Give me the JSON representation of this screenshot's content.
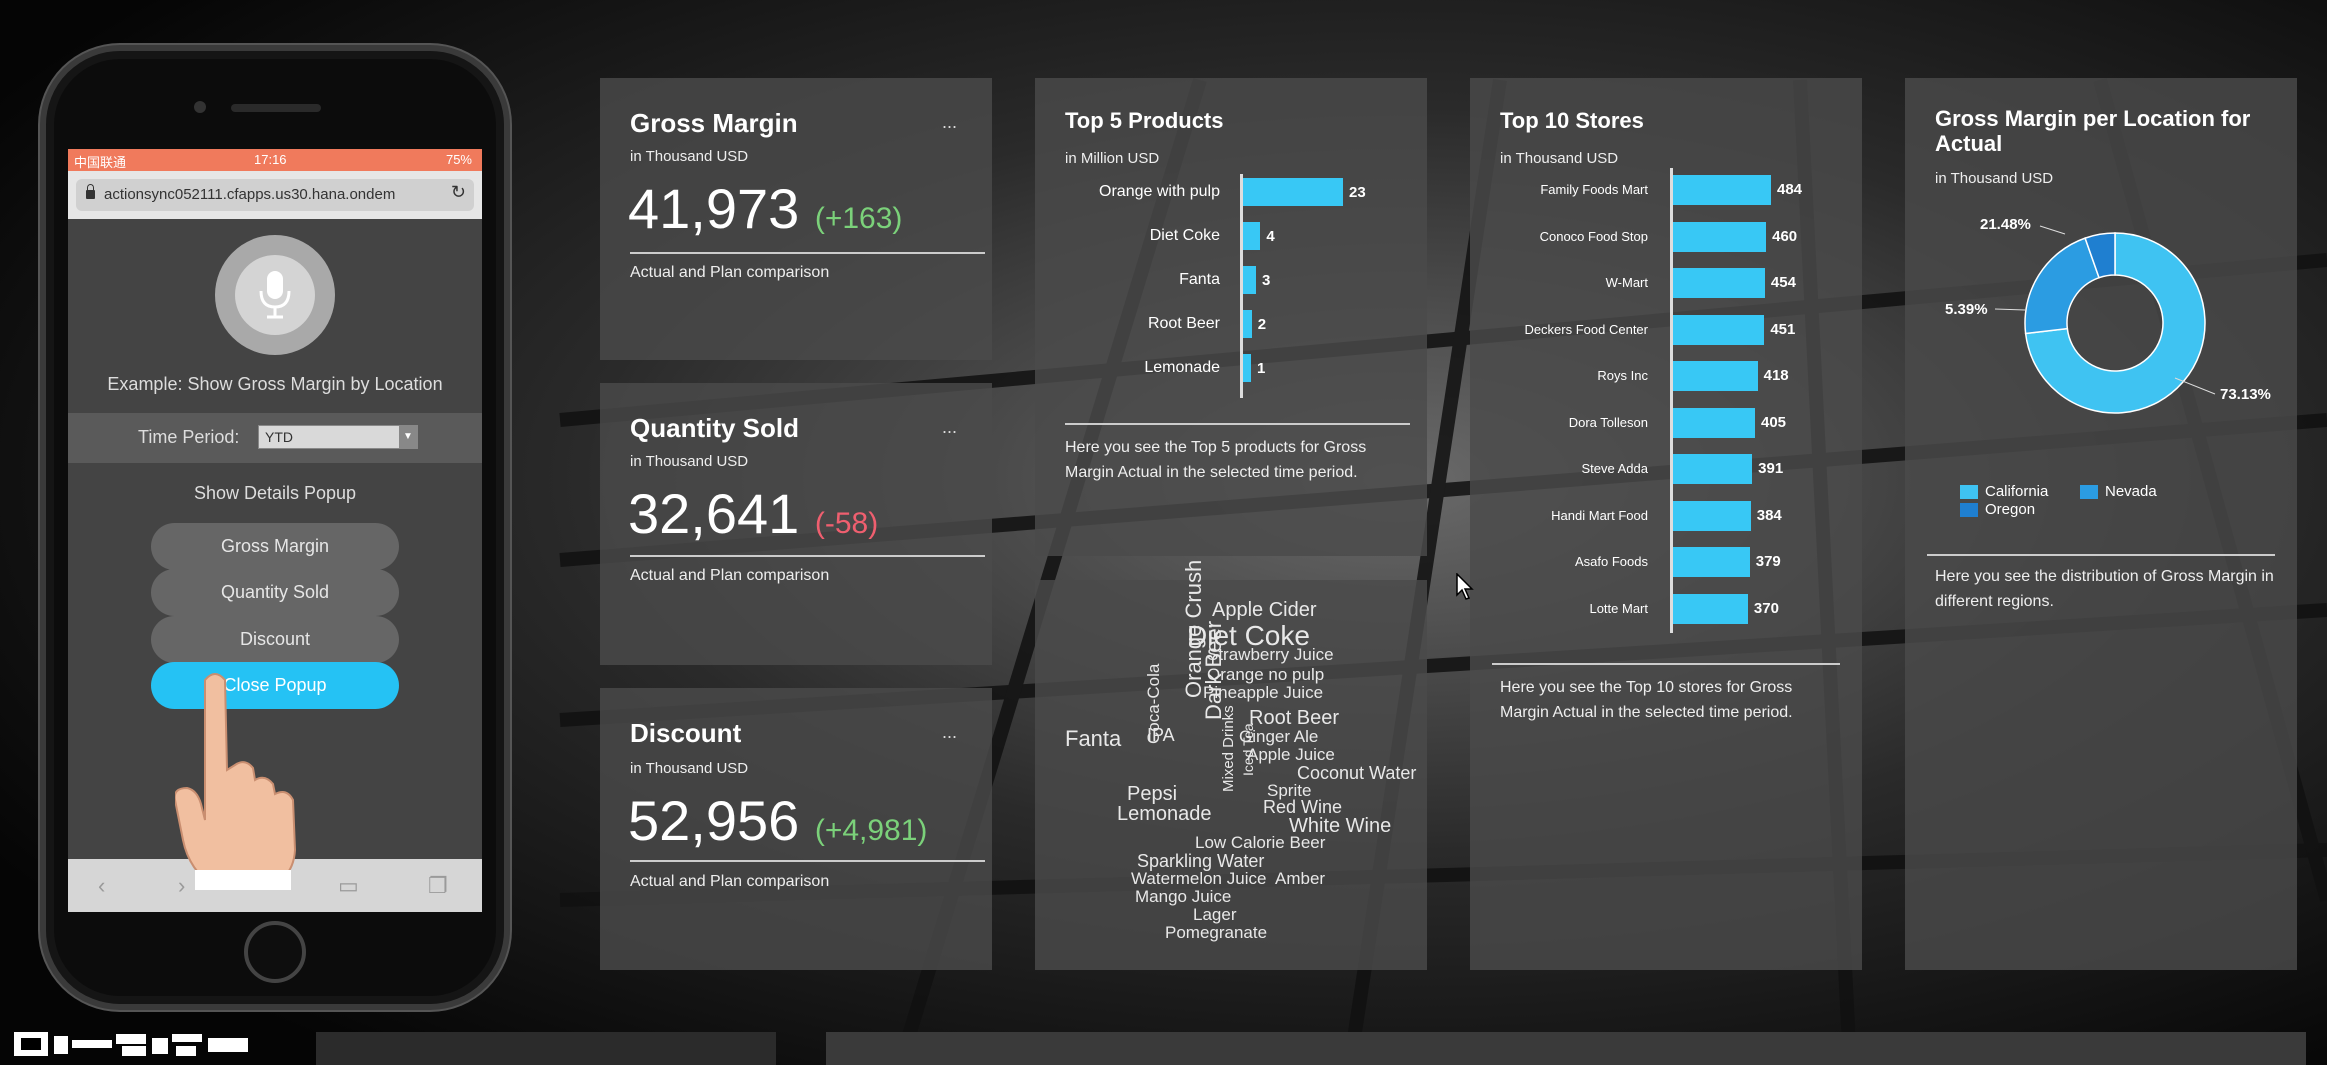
{
  "phone": {
    "status": {
      "carrier": "中国联通",
      "time": "17:16",
      "battery": "75%"
    },
    "url": "actionsync052111.cfapps.us30.hana.ondem",
    "example_text": "Example: Show Gross Margin by Location",
    "time_period_label": "Time Period:",
    "time_period_value": "YTD",
    "show_details": "Show Details Popup",
    "buttons": [
      "Gross Margin",
      "Quantity Sold",
      "Discount",
      "Close Popup"
    ]
  },
  "kpis": [
    {
      "title": "Gross Margin",
      "unit": "in Thousand USD",
      "value": "41,973",
      "delta": "(+163)",
      "note": "Actual and Plan comparison",
      "more": "..."
    },
    {
      "title": "Quantity Sold",
      "unit": "in Thousand USD",
      "value": "32,641",
      "delta": "(-58)",
      "note": "Actual and Plan comparison",
      "more": "..."
    },
    {
      "title": "Discount",
      "unit": "in Thousand USD",
      "value": "52,956",
      "delta": "(+4,981)",
      "note": "Actual and Plan comparison",
      "more": "..."
    }
  ],
  "top_products": {
    "title": "Top 5 Products",
    "unit": "in Million USD",
    "desc": "Here you see the Top 5 products for Gross Margin Actual in the selected time period."
  },
  "top_stores": {
    "title": "Top 10 Stores",
    "unit": "in Thousand USD",
    "desc": "Here you see the Top 10 stores for Gross Margin Actual in the selected time period."
  },
  "gm_location": {
    "title": "Gross Margin per Location for Actual",
    "unit": "in Thousand USD",
    "desc": "Here you see the distribution of Gross Margin in different regions.",
    "pct_labels": [
      "73.13%",
      "21.48%",
      "5.39%"
    ],
    "legend": [
      "California",
      "Nevada",
      "Oregon"
    ],
    "colors": {
      "California": "#3fc3f2",
      "Nevada": "#2b9ce2",
      "Oregon": "#1f7fd0"
    }
  },
  "word_cloud": [
    "Apple Cider",
    "Diet Coke",
    "Strawberry Juice",
    "Orange no pulp",
    "Pineapple Juice",
    "Root Beer",
    "Ginger Ale",
    "Apple Juice",
    "Coconut Water",
    "Sprite",
    "Red Wine",
    "White Wine",
    "Low Calorie Beer",
    "Sparkling Water",
    "Amber",
    "Watermelon Juice",
    "Mango Juice",
    "Lager",
    "Pomegranate",
    "Fanta",
    "IPA",
    "Pepsi",
    "Lemonade",
    "Coca-Cola",
    "Orange Crush",
    "Dark Beer",
    "Iced Tea",
    "Mixed Drinks"
  ],
  "chart_data": [
    {
      "type": "bar",
      "title": "Top 5 Products",
      "subtitle": "in Million USD",
      "categories": [
        "Orange with pulp",
        "Diet Coke",
        "Fanta",
        "Root Beer",
        "Lemonade"
      ],
      "values": [
        23,
        4,
        3,
        2,
        1
      ]
    },
    {
      "type": "bar",
      "title": "Top 10 Stores",
      "subtitle": "in Thousand USD",
      "categories": [
        "Family Foods Mart",
        "Conoco Food Stop",
        "W-Mart",
        "Deckers Food Center",
        "Roys Inc",
        "Dora Tolleson",
        "Steve Adda",
        "Handi Mart Food",
        "Asafo Foods",
        "Lotte Mart"
      ],
      "values": [
        484,
        460,
        454,
        451,
        418,
        405,
        391,
        384,
        379,
        370
      ]
    },
    {
      "type": "pie",
      "title": "Gross Margin per Location for Actual",
      "subtitle": "in Thousand USD",
      "categories": [
        "California",
        "Nevada",
        "Oregon"
      ],
      "values": [
        73.13,
        21.48,
        5.39
      ]
    }
  ]
}
